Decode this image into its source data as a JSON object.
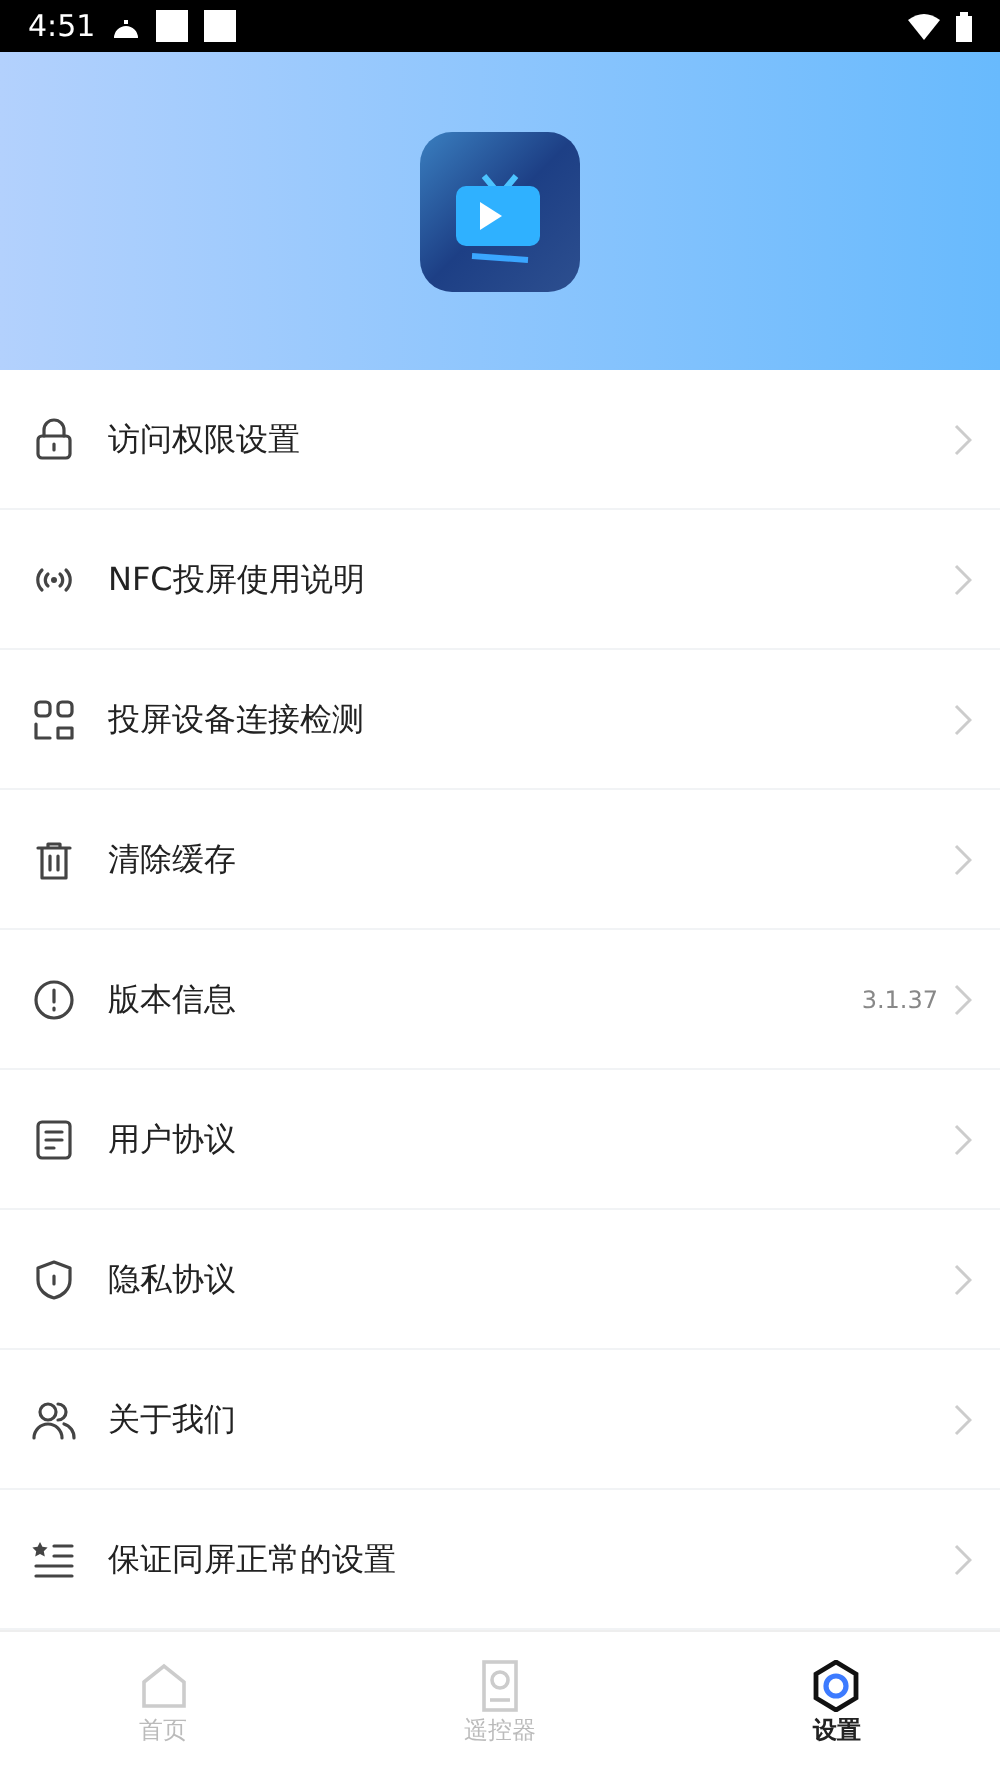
{
  "status_bar": {
    "time": "4:51"
  },
  "menu": [
    {
      "label": "访问权限设置"
    },
    {
      "label": "NFC投屏使用说明"
    },
    {
      "label": "投屏设备连接检测"
    },
    {
      "label": "清除缓存"
    },
    {
      "label": "版本信息",
      "value": "3.1.37"
    },
    {
      "label": "用户协议"
    },
    {
      "label": "隐私协议"
    },
    {
      "label": "关于我们"
    },
    {
      "label": "保证同屏正常的设置"
    }
  ],
  "tabs": [
    {
      "label": "首页",
      "selected": false
    },
    {
      "label": "遥控器",
      "selected": false
    },
    {
      "label": "设置",
      "selected": true
    }
  ]
}
